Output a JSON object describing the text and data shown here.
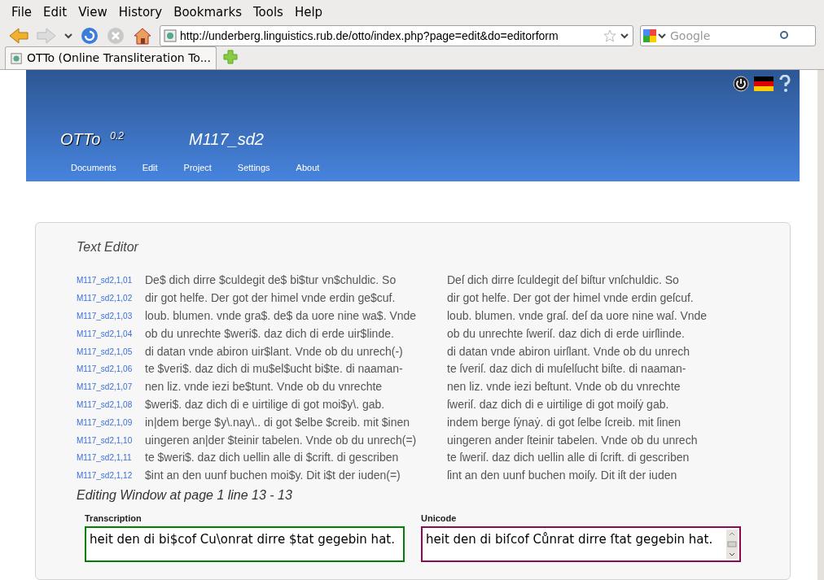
{
  "menu": [
    "File",
    "Edit",
    "View",
    "History",
    "Bookmarks",
    "Tools",
    "Help"
  ],
  "toolbar": {
    "url": "http://underberg.linguistics.rub.de/otto/index.php?page=edit&do=editorform",
    "search_placeholder": "Google"
  },
  "tabs": [
    {
      "label": "OTTo (Online Transliteration To...",
      "selected": true
    }
  ],
  "banner": {
    "app_name": "OTTo",
    "version": "0.2",
    "document": "M117_sd2",
    "nav": [
      "Documents",
      "Edit",
      "Project",
      "Settings",
      "About"
    ]
  },
  "editor": {
    "title": "Text Editor",
    "rows": [
      {
        "line": "M117_sd2,1,01",
        "transcription": "De$ dich dirre $culdegit de$ bi$tur vn$chuldic. So",
        "unicode": "Deſ dich dirre ſculdegit deſ biſtur vnſchuldic. So"
      },
      {
        "line": "M117_sd2,1,02",
        "transcription": "dir got helfe. Der got der himel vnde erdin ge$cuf.",
        "unicode": "dir got helfe. Der got der himel vnde erdin geſcuf."
      },
      {
        "line": "M117_sd2,1,03",
        "transcription": "loub. blumen. vnde gra$. de$ da uore nine wa$. Vnde",
        "unicode": "loub. blumen. vnde graſ. deſ da uore nine waſ. Vnde"
      },
      {
        "line": "M117_sd2,1,04",
        "transcription": "ob du unrechte $weri$. daz dich di erde uir$linde.",
        "unicode": "ob du unrechte ſweriſ. daz dich di erde uirſlinde."
      },
      {
        "line": "M117_sd2,1,05",
        "transcription": "di datan vnde abiron uir$lant. Vnde ob du unrech(-)",
        "unicode": "di datan vnde abiron uirſlant. Vnde ob du unrech"
      },
      {
        "line": "M117_sd2,1,06",
        "transcription": "te $veri$. daz dich di mu$el$ucht bi$te. di naaman-",
        "unicode": "te ſveriſ. daz dich di muſelſucht biſte. di naaman-"
      },
      {
        "line": "M117_sd2,1,07",
        "transcription": "nen liz. vnde iezi be$tunt. Vnde ob du vnrechte",
        "unicode": "nen liz. vnde iezi beſtunt. Vnde ob du vnrechte"
      },
      {
        "line": "M117_sd2,1,08",
        "transcription": "$weri$. daz dich di e uirtilige di got moi$y\\. gab.",
        "unicode": "ſweriſ. daz dich di e uirtilige di got moiſẏ gab."
      },
      {
        "line": "M117_sd2,1,09",
        "transcription": "in|dem berge $y\\.nay\\.. di got $elbe $creib. mit $inen",
        "unicode": "indem berge ſẏnaẏ. di got ſelbe ſcreib. mit ſinen"
      },
      {
        "line": "M117_sd2,1,10",
        "transcription": "uingeren an|der $teinir tabelen. Vnde ob du unrech(=)",
        "unicode": "uingeren ander ſteinir tabelen. Vnde ob du unrech"
      },
      {
        "line": "M117_sd2,1,11",
        "transcription": "te $weri$. daz dich uellin alle di $crift. di gescriben",
        "unicode": "te ſweriſ. daz dich uellin alle di ſcrift. di gescriben"
      },
      {
        "line": "M117_sd2,1,12",
        "transcription": "$int an den uunf buchen moi$y. Dit i$t der iuden(=)",
        "unicode": "ſint an den uunf buchen moiſy. Dit iſt der iuden"
      }
    ],
    "editing_title": "Editing Window at page 1 line 13 - 13",
    "fields": [
      {
        "label": "Transcription",
        "value": "heit den di bi$cof Cu\\onrat dirre $tat gegebin hat.",
        "color": "#008000"
      },
      {
        "label": "Unicode",
        "value": "heit den di biſcof Cůnrat dirre ſtat gegebin hat.",
        "color": "#8b0a50"
      }
    ]
  }
}
